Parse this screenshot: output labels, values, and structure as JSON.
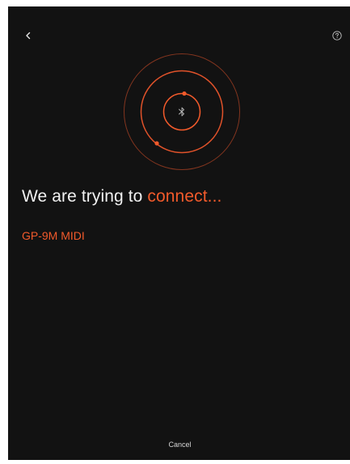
{
  "header": {
    "back_icon": "chevron-left-icon",
    "help_icon": "question-circle-icon"
  },
  "radar": {
    "center_icon": "bluetooth-icon",
    "accent_color": "#f25a2b",
    "ring_color": "#e0522a"
  },
  "main": {
    "headline_prefix": "We are trying to ",
    "headline_accent": "connect...",
    "device_name": "GP-9M MIDI"
  },
  "footer": {
    "cancel_label": "Cancel"
  },
  "colors": {
    "background": "#121212",
    "text": "#f1f1f1",
    "accent": "#f25a2b"
  }
}
